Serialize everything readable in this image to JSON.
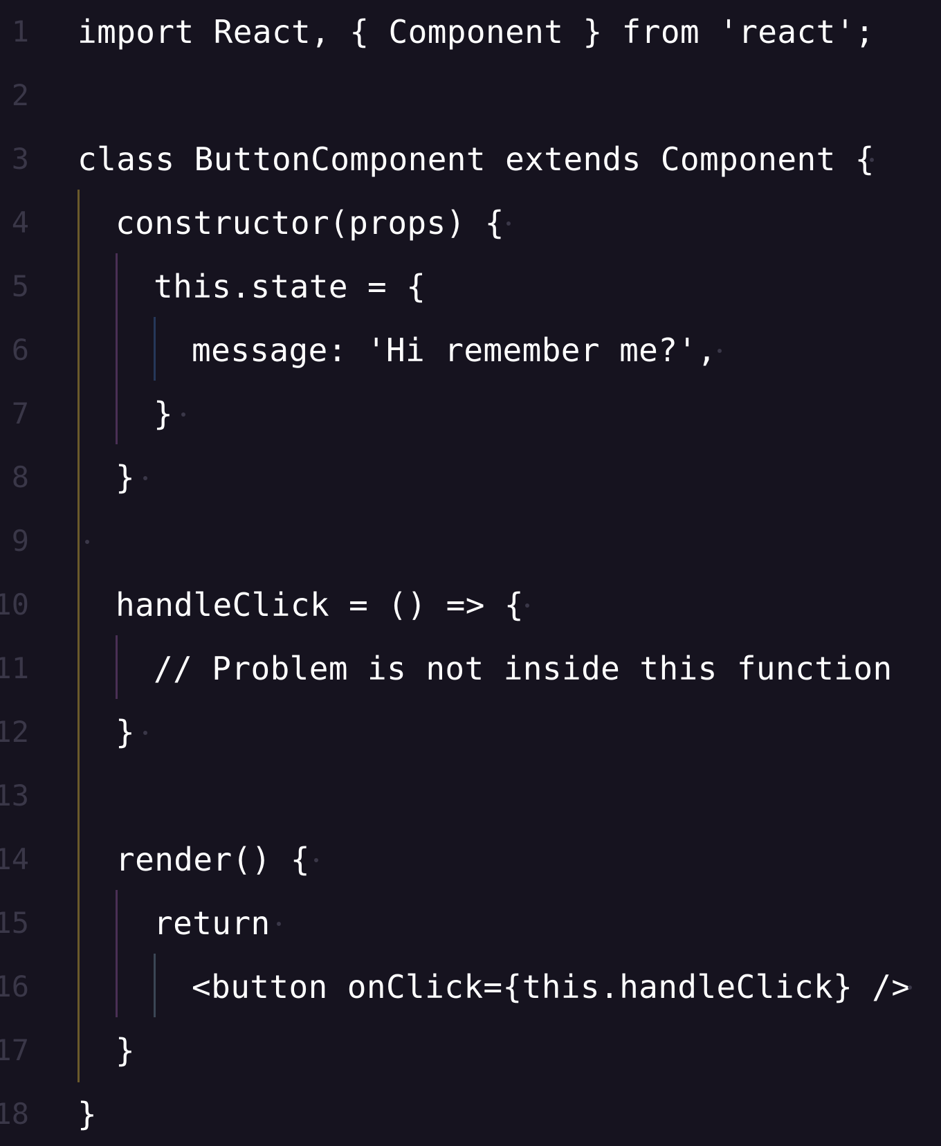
{
  "editor": {
    "background": "#16131f",
    "text_color": "#ffffff",
    "line_number_color": "#3a3748",
    "lines": [
      {
        "num": "1",
        "text": "import React, { Component } from 'react';"
      },
      {
        "num": "2",
        "text": ""
      },
      {
        "num": "3",
        "text": "class ButtonComponent extends Component {"
      },
      {
        "num": "4",
        "text": "constructor(props) {"
      },
      {
        "num": "5",
        "text": "this.state = {"
      },
      {
        "num": "6",
        "text": "message: 'Hi remember me?',"
      },
      {
        "num": "7",
        "text": "}"
      },
      {
        "num": "8",
        "text": "}"
      },
      {
        "num": "9",
        "text": ""
      },
      {
        "num": "10",
        "text": "handleClick = () => {"
      },
      {
        "num": "11",
        "text": "// Problem is not inside this function"
      },
      {
        "num": "12",
        "text": "}"
      },
      {
        "num": "13",
        "text": ""
      },
      {
        "num": "14",
        "text": "render() {"
      },
      {
        "num": "15",
        "text": "return"
      },
      {
        "num": "16",
        "text": "<button onClick={this.handleClick} />"
      },
      {
        "num": "17",
        "text": "}"
      },
      {
        "num": "18",
        "text": "}"
      }
    ]
  }
}
